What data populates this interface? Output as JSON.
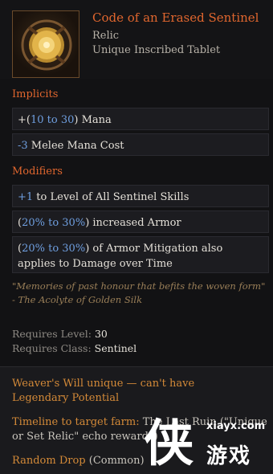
{
  "item": {
    "name": "Code of an Erased Sentinel",
    "rarity": "Relic",
    "type": "Unique Inscribed Tablet",
    "icon": "golden-tablet-icon"
  },
  "implicits": {
    "title": "Implicits",
    "lines": [
      {
        "prefix": "+(",
        "range": "10 to 30",
        "suffix": ") Mana"
      },
      {
        "num": "-3",
        "text": " Melee Mana Cost"
      }
    ]
  },
  "modifiers": {
    "title": "Modifiers",
    "lines": [
      {
        "num": "+1",
        "text": " to Level of All Sentinel Skills"
      },
      {
        "prefix": "(",
        "range": "20% to 30%",
        "suffix": ") increased Armor"
      },
      {
        "prefix": "(",
        "range": "20% to 30%",
        "suffix": ") of Armor Mitigation also applies to Damage over Time"
      }
    ]
  },
  "lore": {
    "quote": "\"Memories of past honour that befits the woven form\"",
    "author": "- The Acolyte of Golden Silk"
  },
  "requirements": {
    "level_label": "Requires Level:",
    "level_value": "30",
    "class_label": "Requires Class:",
    "class_value": "Sentinel"
  },
  "footer": {
    "weaver_note": "Weaver's Will unique — can't have Legendary Potential",
    "timeline_label": "Timeline to target farm:",
    "timeline_value": "The Last Ruin (\"Unique or Set Relic\" echo rewards)",
    "drop_label": "Random Drop",
    "drop_value": "(Common)"
  },
  "watermark": {
    "site": "xiayx.com",
    "word": "游戏",
    "glyph": "侠"
  },
  "colors": {
    "accent_orange": "#e0662e",
    "value_blue": "#6f9fe0",
    "lore_gold": "#9a7f58",
    "footer_orange": "#d48a38"
  }
}
